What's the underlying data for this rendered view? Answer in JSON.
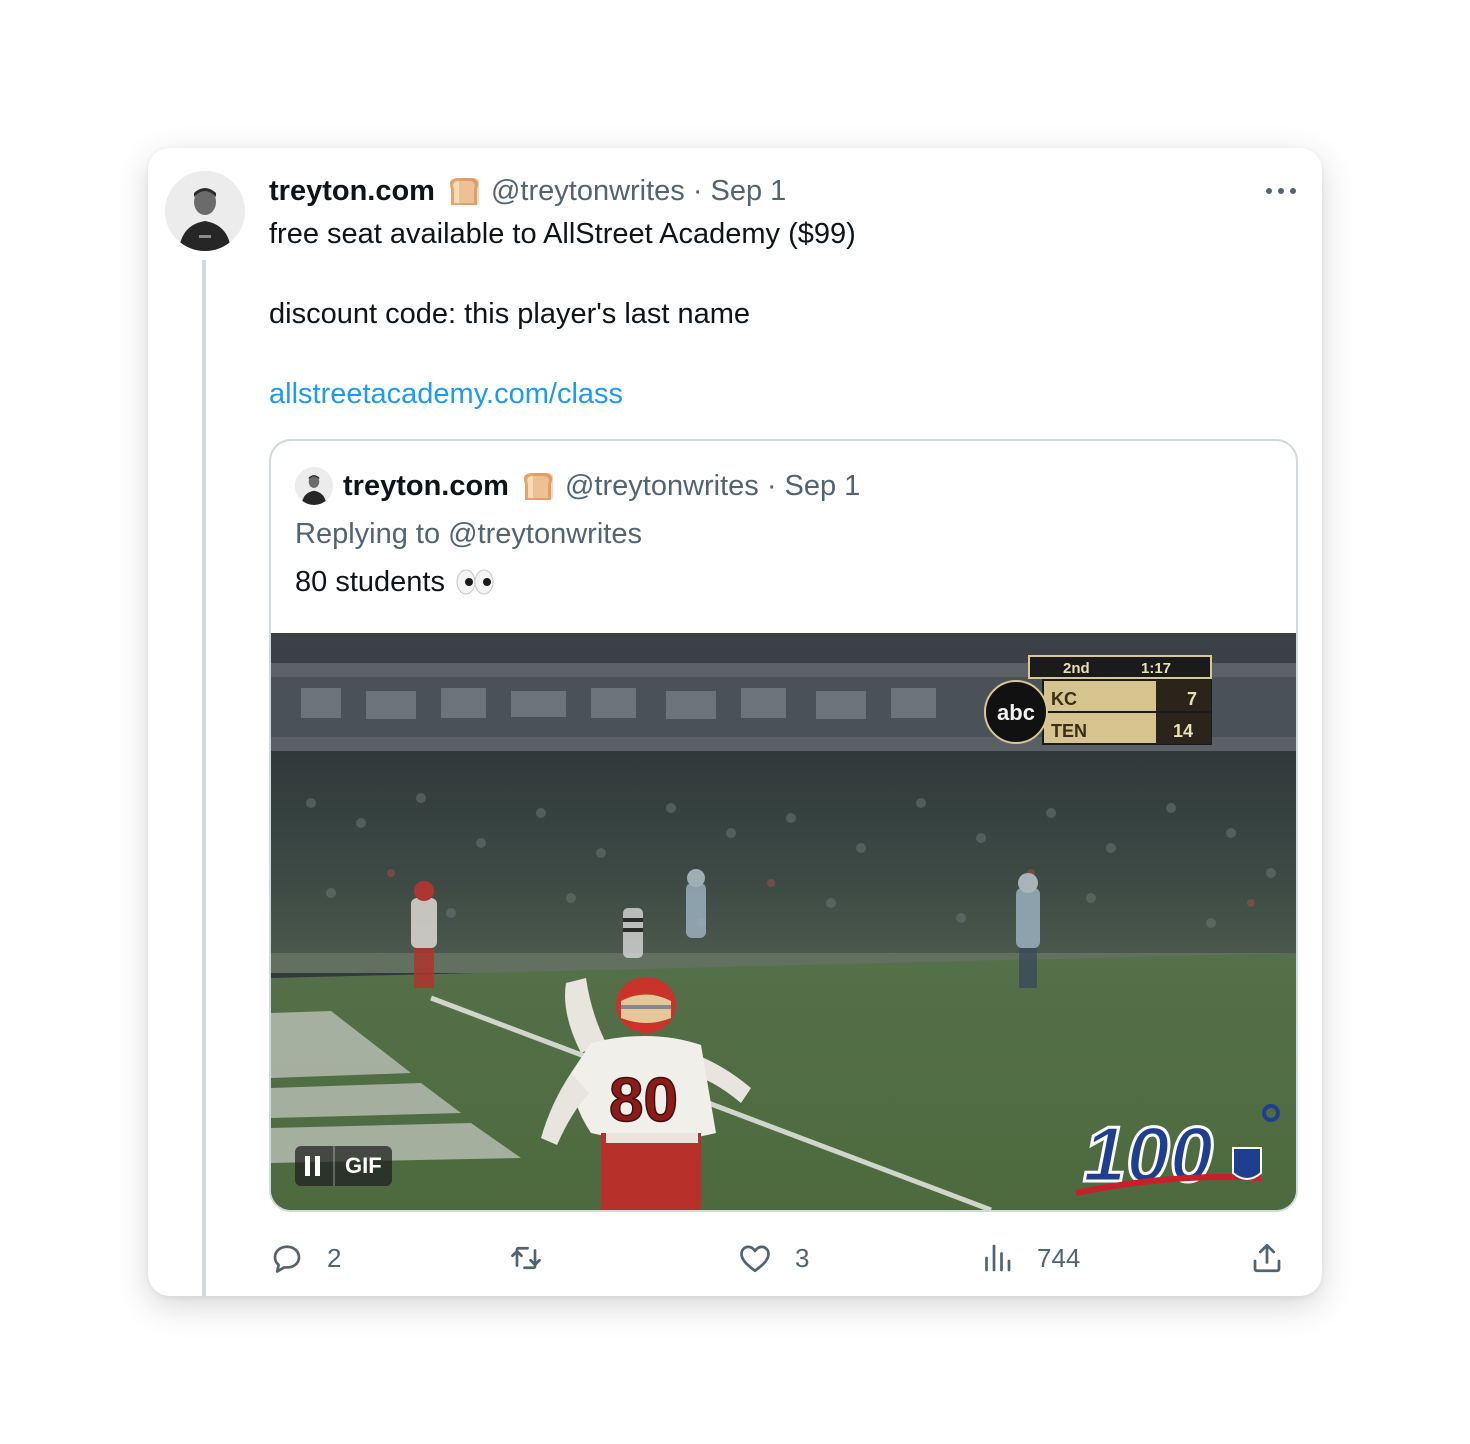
{
  "tweet": {
    "author_name": "treyton.com",
    "author_emoji_icon": "bread-icon",
    "handle": "@treytonwrites",
    "separator": "·",
    "date": "Sep 1",
    "text_line1": "free seat available to AllStreet Academy ($99)",
    "text_line2": "discount code: this player's last name",
    "link_text": "allstreetacademy.com/class"
  },
  "quoted_tweet": {
    "author_name": "treyton.com",
    "author_emoji_icon": "bread-icon",
    "handle": "@treytonwrites",
    "separator": "·",
    "date": "Sep 1",
    "replying_to": "Replying to @treytonwrites",
    "text": "80 students",
    "text_emoji_icon": "eyes-icon",
    "media": {
      "type": "GIF",
      "badge_label": "GIF",
      "scoreboard": {
        "network": "abc",
        "quarter": "2nd",
        "clock": "1:17",
        "team1": "KC",
        "score1": "7",
        "team2": "TEN",
        "score2": "14"
      },
      "jersey_number": "80",
      "logo_text": "100"
    }
  },
  "actions": {
    "reply_count": "2",
    "retweet_count": "",
    "like_count": "3",
    "views_count": "744"
  },
  "colors": {
    "text_primary": "#0f1419",
    "text_secondary": "#536471",
    "link": "#1d9bf0",
    "border": "#cfd9de"
  }
}
